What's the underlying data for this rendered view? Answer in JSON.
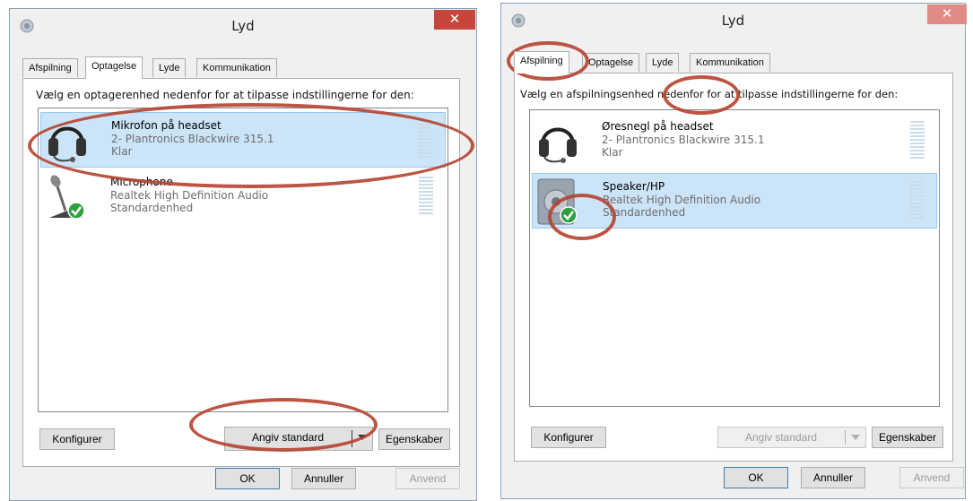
{
  "left_dialog": {
    "title": "Lyd",
    "close_glyph": "✕",
    "tabs": [
      "Afspilning",
      "Optagelse",
      "Lyde",
      "Kommunikation"
    ],
    "active_tab": "Optagelse",
    "instruction": "Vælg en optagerenhed nedenfor for at tilpasse indstillingerne for den:",
    "devices": [
      {
        "name": "Mikrofon på headset",
        "line1": "2- Plantronics Blackwire 315.1",
        "line2": "Klar",
        "icon": "headset-icon",
        "selected": true
      },
      {
        "name": "Microphone",
        "line1": "Realtek High Definition Audio",
        "line2": "Standardenhed",
        "icon": "microphone-icon",
        "selected": false,
        "default": true
      }
    ],
    "configure_label": "Konfigurer",
    "set_default_label": "Angiv standard",
    "properties_label": "Egenskaber",
    "ok_label": "OK",
    "cancel_label": "Annuller",
    "apply_label": "Anvend"
  },
  "right_dialog": {
    "title": "Lyd",
    "close_glyph": "✕",
    "tabs": [
      "Afspilning",
      "Optagelse",
      "Lyde",
      "Kommunikation"
    ],
    "active_tab": "Afspilning",
    "instruction": "Vælg en afspilningsenhed nedenfor for at tilpasse indstillingerne for den:",
    "devices": [
      {
        "name": "Øresnegl på headset",
        "line1": "2- Plantronics Blackwire 315.1",
        "line2": "Klar",
        "icon": "headset-icon",
        "selected": false
      },
      {
        "name": "Speaker/HP",
        "line1": "Realtek High Definition Audio",
        "line2": "Standardenhed",
        "icon": "speaker-icon",
        "selected": true,
        "default": true
      }
    ],
    "configure_label": "Konfigurer",
    "set_default_label": "Angiv standard",
    "properties_label": "Egenskaber",
    "ok_label": "OK",
    "cancel_label": "Annuller",
    "apply_label": "Anvend"
  },
  "colors": {
    "highlight_ring": "#b5432f",
    "close_button": "#c7453b",
    "selection": "#cce4f7",
    "default_check": "#2ea043"
  }
}
